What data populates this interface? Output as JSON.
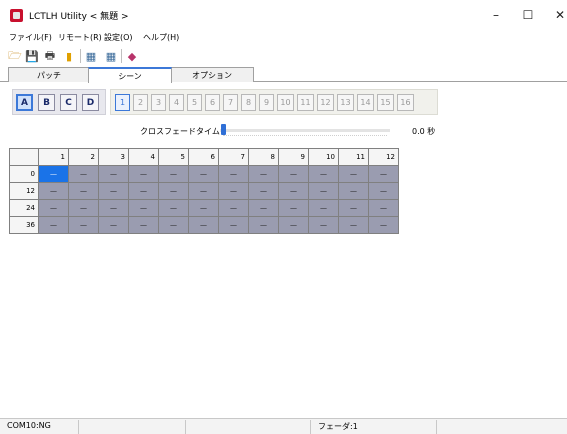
{
  "window": {
    "title": "LCTLH Utility < 無題 >",
    "minimize": "–",
    "maximize": "☐",
    "close": "✕"
  },
  "menu": [
    "ファイル(F)",
    "リモート(R)",
    "設定(O)",
    "ヘルプ(H)"
  ],
  "toolbar": {
    "icons": [
      "open-folder-icon",
      "save-icon",
      "print-icon",
      "exit-icon",
      "grid-copy-icon",
      "grid-paste-icon",
      "palette-icon"
    ],
    "glyphs": [
      "🗁",
      "💾",
      "🖶",
      "▮",
      "▦",
      "▦",
      "◆"
    ]
  },
  "tabs": [
    {
      "label": "パッチ",
      "active": false
    },
    {
      "label": "シーン",
      "active": true
    },
    {
      "label": "オプション",
      "active": false
    }
  ],
  "banks": {
    "items": [
      "A",
      "B",
      "C",
      "D"
    ],
    "selected": "A"
  },
  "scenes": {
    "items": [
      "1",
      "2",
      "3",
      "4",
      "5",
      "6",
      "7",
      "8",
      "9",
      "10",
      "11",
      "12",
      "13",
      "14",
      "15",
      "16"
    ],
    "selected": "1"
  },
  "crossfade": {
    "label": "クロスフェードタイム",
    "value": "0.0 秒",
    "level": 0
  },
  "grid": {
    "columns": [
      "1",
      "2",
      "3",
      "4",
      "5",
      "6",
      "7",
      "8",
      "9",
      "10",
      "11",
      "12"
    ],
    "rows": [
      {
        "label": "0",
        "cells": [
          "—",
          "—",
          "—",
          "—",
          "—",
          "—",
          "—",
          "—",
          "—",
          "—",
          "—",
          "—"
        ]
      },
      {
        "label": "12",
        "cells": [
          "—",
          "—",
          "—",
          "—",
          "—",
          "—",
          "—",
          "—",
          "—",
          "—",
          "—",
          "—"
        ]
      },
      {
        "label": "24",
        "cells": [
          "—",
          "—",
          "—",
          "—",
          "—",
          "—",
          "—",
          "—",
          "—",
          "—",
          "—",
          "—"
        ]
      },
      {
        "label": "36",
        "cells": [
          "—",
          "—",
          "—",
          "—",
          "—",
          "—",
          "—",
          "—",
          "—",
          "—",
          "—",
          "—"
        ]
      }
    ],
    "selected_cell": [
      0,
      0
    ]
  },
  "status": {
    "port": "COM10:NG",
    "fader": "フェーダ:1"
  },
  "colors": {
    "accent": "#3c78d8",
    "cell_fill": "#9a9cb0",
    "cell_selected": "#1a73e8"
  }
}
